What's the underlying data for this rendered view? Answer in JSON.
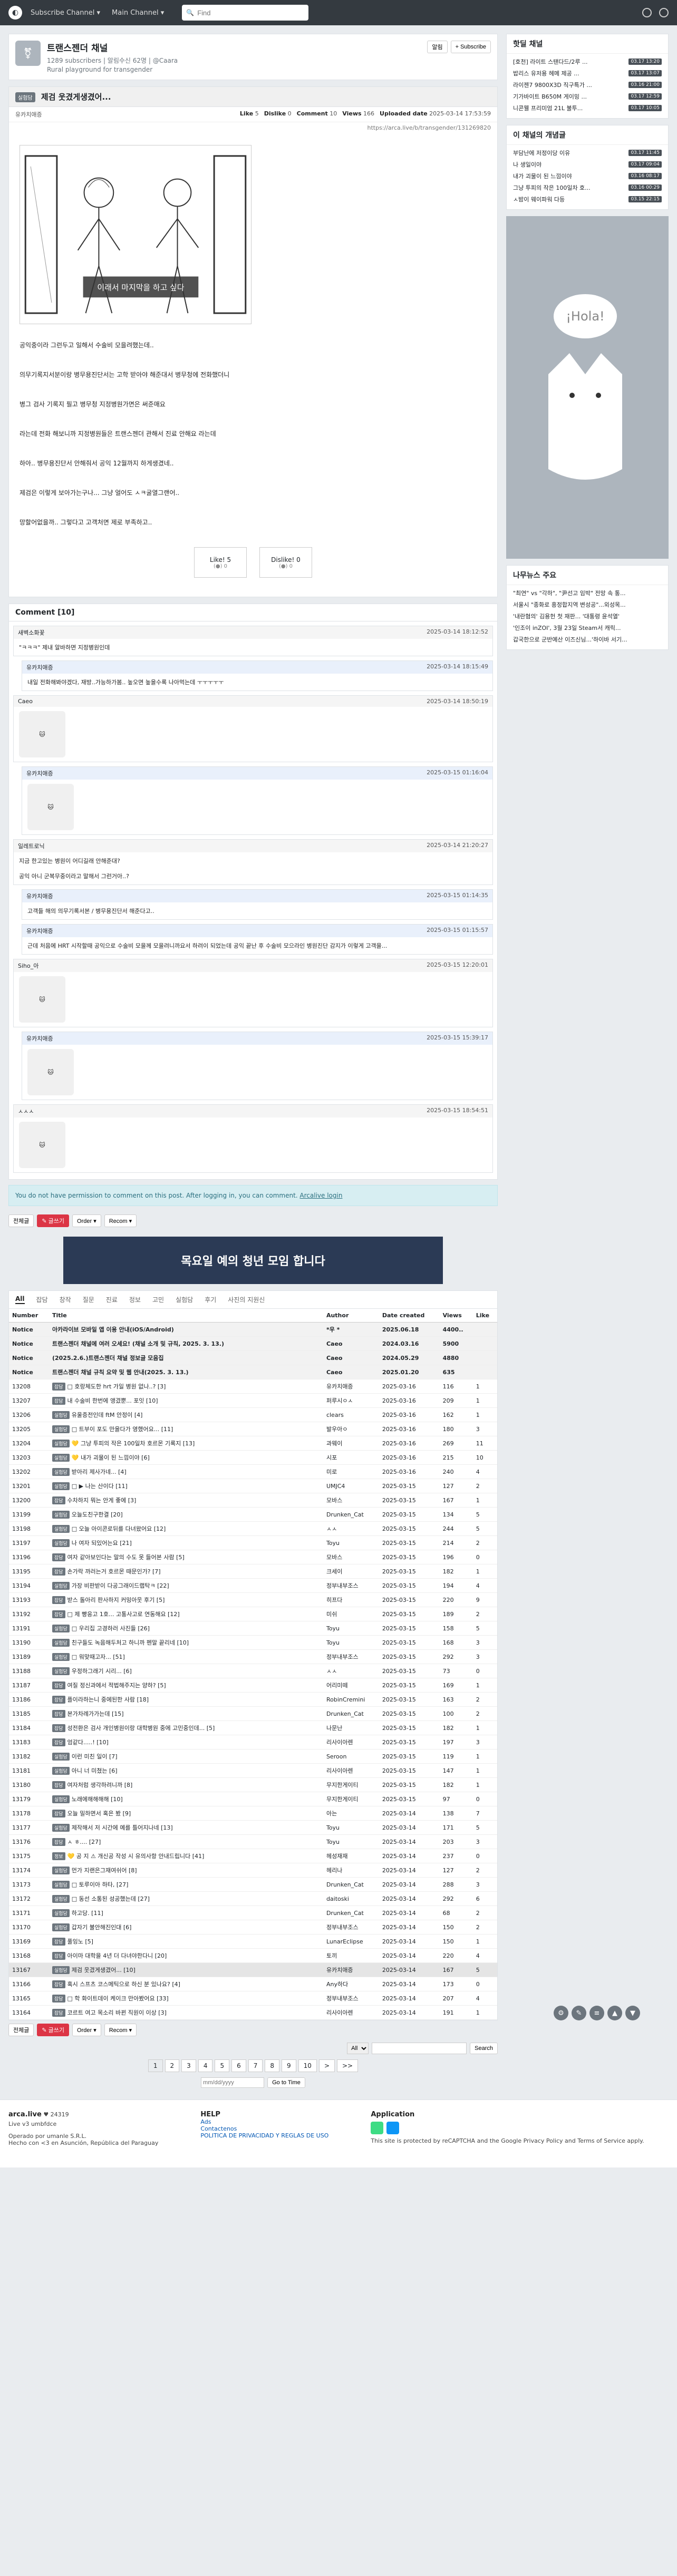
{
  "nav": {
    "subscribe_channel": "Subscribe Channel ▾",
    "main_channel": "Main Channel ▾",
    "search_placeholder": "Find"
  },
  "channel": {
    "title": "트랜스젠더 채널",
    "stats": "1289 subscribers | 알림수신 62명 | @Caara",
    "desc": "Rural playground for transgender",
    "btn_alarm": "알림",
    "btn_subscribe": "+ Subscribe"
  },
  "article": {
    "badge": "실험담",
    "title": "제검 웃겼게생겼어...",
    "author": "유카치애증",
    "like_label": "Like",
    "like_val": "5",
    "dislike_label": "Dislike",
    "dislike_val": "0",
    "comment_label": "Comment",
    "comment_val": "10",
    "views_label": "Views",
    "views_val": "166",
    "uploaded_label": "Uploaded date",
    "uploaded_val": "2025-03-14 17:53:59",
    "link": "https://arca.live/b/transgender/131269820",
    "comic_caption": "이래서 마지막을 하고 싶다",
    "paragraphs": [
      "공익중이라 그런두고 일해서 수술비 모을려했는데..",
      "의무기록지서분이랑 병무용진단서는 고학 받아야 해준대서 병무청에 전화했더니",
      "병그 검사 기록지 필고 병무청 지정병원가면은 써준매요",
      "라는데 전화 해보니까 지정병원들은 트랜스젠더 관해서 진료 안해요 라는데",
      "하아.. 병무용진단서 안해줘서 공익 12월까지 하게생겼네..",
      "제검은 이렇게 보아가는구나... 그냥 얼어도 ㅅㅋ굴열그랜어..",
      "망할어없을까.. 그렇다고 고객처면 제로 부족하고.."
    ],
    "like_btn": "Like! 5",
    "like_count": "(●) 0",
    "dislike_btn": "Dislike! 0",
    "dislike_count": "(●) 0"
  },
  "comments_title": "Comment [10]",
  "comments": [
    {
      "author": "새벽소화꽃",
      "date": "2025-03-14 18:12:52",
      "body": "\"ㅋㅋㅋ\" 제내 알바하면 지정병원인데",
      "reply": false,
      "sticker": false
    },
    {
      "author": "유카치애증",
      "date": "2025-03-14 18:15:49",
      "body": "내일 전화해봐야겠다, 재방..가능하가봄.. 높오면 높을수록 나아먹는데 ㅜㅜㅜㅜㅜ",
      "reply": true,
      "sticker": false
    },
    {
      "author": "Caeo",
      "date": "2025-03-14 18:50:19",
      "body": "",
      "reply": false,
      "sticker": true
    },
    {
      "author": "유카치애증",
      "date": "2025-03-15 01:16:04",
      "body": "",
      "reply": true,
      "sticker": true
    },
    {
      "author": "일레트로닉",
      "date": "2025-03-14 21:20:27",
      "body": "지금 한고있는 병원이 어디길래 안해준대?\n\n공익 아니 군복무중이라고 말해서 그런거아..?",
      "reply": false,
      "sticker": false
    },
    {
      "author": "유카치애증",
      "date": "2025-03-15 01:14:35",
      "body": "고객들 해의 의무기록서본 / 병무용진단서 해준다고..",
      "reply": true,
      "sticker": false
    },
    {
      "author": "유카치애증",
      "date": "2025-03-15 01:15:57",
      "body": "근데 처음에 HRT 시작할때 공익으로 수술비 모을께 모을려니까요서 하려이 되었는데 공익 끝난 후 수술비 모으라인 병원진단 감지가 이렇게 고객을...",
      "reply": true,
      "sticker": false
    },
    {
      "author": "Siho_아",
      "date": "2025-03-15 12:20:01",
      "body": "",
      "reply": false,
      "sticker": true
    },
    {
      "author": "유카치애증",
      "date": "2025-03-15 15:39:17",
      "body": "",
      "reply": true,
      "sticker": true
    },
    {
      "author": "ㅅㅅㅅ",
      "date": "2025-03-15 18:54:51",
      "body": "",
      "reply": false,
      "sticker": true
    }
  ],
  "permission": {
    "text": "You do not have permission to comment on this post. After logging in, you can comment.",
    "link": "Arcalive login"
  },
  "toolbar": {
    "list": "전체글",
    "write": "✎ 글쓰기",
    "order": "Order ▾",
    "recom": "Recom ▾"
  },
  "banner_text": "목요일 예의 청년 모임 합니다",
  "categories": [
    "All",
    "잡담",
    "창작",
    "질문",
    "진료",
    "정보",
    "고민",
    "실험담",
    "후기",
    "사진의 지원신"
  ],
  "table": {
    "headers": [
      "Number",
      "Title",
      "Author",
      "Date created",
      "Views",
      "Like"
    ],
    "rows": [
      {
        "num": "Notice",
        "tag": "",
        "title": "아카라이브 모바일 앱 이용 안내(iOS/Android)",
        "author": "*우 *",
        "date": "2025.06.18",
        "views": "4400..",
        "like": "",
        "type": "notice"
      },
      {
        "num": "Notice",
        "tag": "",
        "title": "트랜스젠더 채널에 여러 오세요! (채널 소개 및 규칙, 2025. 3. 13.)",
        "author": "Caeo",
        "date": "2024.03.16",
        "views": "5900",
        "like": "",
        "type": "notice"
      },
      {
        "num": "Notice",
        "tag": "",
        "title": "(2025.2.6.)트랜스젠더 채널 정보글 모음집",
        "author": "Caeo",
        "date": "2024.05.29",
        "views": "4880",
        "like": "",
        "type": "notice"
      },
      {
        "num": "Notice",
        "tag": "",
        "title": "트랜스젠더 채널 규칙 요약 및 웹 안내(2025. 3. 13.)",
        "author": "Caeo",
        "date": "2025.01.20",
        "views": "635",
        "like": "",
        "type": "notice"
      },
      {
        "num": "13208",
        "tag": "잡담",
        "title": "□ 호랑체도한 hrt 가일 병원 없나..? [3]",
        "author": "유카치애증",
        "date": "2025-03-16",
        "views": "116",
        "like": "1",
        "type": ""
      },
      {
        "num": "13207",
        "tag": "잡담",
        "title": "내 수술비 한번에 앵겼뿐... 포잇 [10]",
        "author": "퍼루시ㅇㅅ",
        "date": "2025-03-16",
        "views": "209",
        "like": "1",
        "type": ""
      },
      {
        "num": "13206",
        "tag": "실험담",
        "title": "유울증전인데 ftM 안정이 [4]",
        "author": "clears",
        "date": "2025-03-16",
        "views": "162",
        "like": "1",
        "type": ""
      },
      {
        "num": "13205",
        "tag": "실험담",
        "title": "□ 트부이 포도 만을다가 영했어요... [11]",
        "author": "발우아ㅇ",
        "date": "2025-03-16",
        "views": "180",
        "like": "3",
        "type": ""
      },
      {
        "num": "13204",
        "tag": "실험담",
        "title": "💛 그냥 투피의 작은 100일차 호르몬 기록지 [13]",
        "author": "과웨이",
        "date": "2025-03-16",
        "views": "269",
        "like": "11",
        "type": ""
      },
      {
        "num": "13203",
        "tag": "실험담",
        "title": "💛 내가 괴물이 된 느낌이야 [6]",
        "author": "시포",
        "date": "2025-03-16",
        "views": "215",
        "like": "10",
        "type": ""
      },
      {
        "num": "13202",
        "tag": "실험담",
        "title": "받아리 제사가네... [4]",
        "author": "미로",
        "date": "2025-03-16",
        "views": "240",
        "like": "4",
        "type": ""
      },
      {
        "num": "13201",
        "tag": "실험담",
        "title": "□ ▶ 나는 산이다 [11]",
        "author": "UMJC4",
        "date": "2025-03-15",
        "views": "127",
        "like": "2",
        "type": ""
      },
      {
        "num": "13200",
        "tag": "잡담",
        "title": "수차하지 뭐는 안게 좋에 [3]",
        "author": "모바스",
        "date": "2025-03-15",
        "views": "167",
        "like": "1",
        "type": ""
      },
      {
        "num": "13199",
        "tag": "실험담",
        "title": "오늘도친구한결 [20]",
        "author": "Drunken_Cat",
        "date": "2025-03-15",
        "views": "134",
        "like": "5",
        "type": ""
      },
      {
        "num": "13198",
        "tag": "실험담",
        "title": "□ 오늘 아이콘로뒤를 다녀왔어요 [12]",
        "author": "ㅅㅅ",
        "date": "2025-03-15",
        "views": "244",
        "like": "5",
        "type": ""
      },
      {
        "num": "13197",
        "tag": "실험담",
        "title": "나 여자 되있어는요 [21]",
        "author": "Toyu",
        "date": "2025-03-15",
        "views": "214",
        "like": "2",
        "type": ""
      },
      {
        "num": "13196",
        "tag": "잡담",
        "title": "여자 같아보인다는 말의 수도 못 들어본 사람 [5]",
        "author": "모바스",
        "date": "2025-03-15",
        "views": "196",
        "like": "0",
        "type": ""
      },
      {
        "num": "13195",
        "tag": "잡담",
        "title": "손가락 까러는거 호르몬 때문인가? [7]",
        "author": "크세이",
        "date": "2025-03-15",
        "views": "182",
        "like": "1",
        "type": ""
      },
      {
        "num": "13194",
        "tag": "실험담",
        "title": "가장 비판받이 다공그래이드랩탁ㅋ [22]",
        "author": "정부내부조스",
        "date": "2025-03-15",
        "views": "194",
        "like": "4",
        "type": ""
      },
      {
        "num": "13193",
        "tag": "잡담",
        "title": "받스 돌아리 판사하지 커밍아웃 후기 [5]",
        "author": "히프다",
        "date": "2025-03-15",
        "views": "220",
        "like": "9",
        "type": ""
      },
      {
        "num": "13192",
        "tag": "잡담",
        "title": "□ 제 빵응고 1호... 고통사고로 연동해요 [12]",
        "author": "미쉬",
        "date": "2025-03-15",
        "views": "189",
        "like": "2",
        "type": ""
      },
      {
        "num": "13191",
        "tag": "실험담",
        "title": "□ 우리집 고경하러 사진들 [26]",
        "author": "Toyu",
        "date": "2025-03-15",
        "views": "158",
        "like": "5",
        "type": ""
      },
      {
        "num": "13190",
        "tag": "실험담",
        "title": "친구들도 녹음해두처고 하니까 펜말 끝리네 [10]",
        "author": "Toyu",
        "date": "2025-03-15",
        "views": "168",
        "like": "3",
        "type": ""
      },
      {
        "num": "13189",
        "tag": "실험담",
        "title": "□ 워맞때고자... [51]",
        "author": "정부내부조스",
        "date": "2025-03-15",
        "views": "292",
        "like": "3",
        "type": ""
      },
      {
        "num": "13188",
        "tag": "실험담",
        "title": "우정하그래기 시리... [6]",
        "author": "ㅅㅅ",
        "date": "2025-03-15",
        "views": "73",
        "like": "0",
        "type": ""
      },
      {
        "num": "13187",
        "tag": "잡담",
        "title": "여질 정신과에서 적법해주지는 양하? [5]",
        "author": "어리미떼",
        "date": "2025-03-15",
        "views": "169",
        "like": "1",
        "type": ""
      },
      {
        "num": "13186",
        "tag": "잡담",
        "title": "플이라하는니 중에된한 사람 [18]",
        "author": "RobinCremini",
        "date": "2025-03-15",
        "views": "163",
        "like": "2",
        "type": ""
      },
      {
        "num": "13185",
        "tag": "잡담",
        "title": "본가차례가가는데 [15]",
        "author": "Drunken_Cat",
        "date": "2025-03-15",
        "views": "100",
        "like": "2",
        "type": ""
      },
      {
        "num": "13184",
        "tag": "잡담",
        "title": "성전환은 검사 개인병원이랑 대학병원 중에 고민중인데... [5]",
        "author": "나문난",
        "date": "2025-03-15",
        "views": "182",
        "like": "1",
        "type": ""
      },
      {
        "num": "13183",
        "tag": "잡담",
        "title": "엄같다.....! [10]",
        "author": "리사이아렌",
        "date": "2025-03-15",
        "views": "197",
        "like": "3",
        "type": ""
      },
      {
        "num": "13182",
        "tag": "실험담",
        "title": "이런 미친 일이 [7]",
        "author": "Seroon",
        "date": "2025-03-15",
        "views": "119",
        "like": "1",
        "type": ""
      },
      {
        "num": "13181",
        "tag": "실험담",
        "title": "아니 너 미쳤는 [6]",
        "author": "리사이아렌",
        "date": "2025-03-15",
        "views": "147",
        "like": "1",
        "type": ""
      },
      {
        "num": "13180",
        "tag": "잡담",
        "title": "여자처럼 생각하려니까 [8]",
        "author": "무지한게이티",
        "date": "2025-03-15",
        "views": "182",
        "like": "1",
        "type": ""
      },
      {
        "num": "13179",
        "tag": "실험담",
        "title": "노래에해해해해 [10]",
        "author": "무지한게이티",
        "date": "2025-03-15",
        "views": "97",
        "like": "0",
        "type": ""
      },
      {
        "num": "13178",
        "tag": "잡담",
        "title": "오늘 밀하면서 혹은 봤 [9]",
        "author": "아는",
        "date": "2025-03-14",
        "views": "138",
        "like": "7",
        "type": ""
      },
      {
        "num": "13177",
        "tag": "실험담",
        "title": "제작해서 저 시간에 예를 틀어지나네 [13]",
        "author": "Toyu",
        "date": "2025-03-14",
        "views": "171",
        "like": "5",
        "type": ""
      },
      {
        "num": "13176",
        "tag": "잡담",
        "title": "ㅅ ㅎ.... [27]",
        "author": "Toyu",
        "date": "2025-03-14",
        "views": "203",
        "like": "3",
        "type": ""
      },
      {
        "num": "13175",
        "tag": "정보",
        "title": "💛 공 지 ⚠ 개신공 작성 시 유의사항 안내드립니다 [41]",
        "author": "헤성재재",
        "date": "2025-03-14",
        "views": "237",
        "like": "0",
        "type": ""
      },
      {
        "num": "13174",
        "tag": "실험담",
        "title": "먼가 지랜은그재여쉬어 [8]",
        "author": "헤리나",
        "date": "2025-03-14",
        "views": "127",
        "like": "2",
        "type": ""
      },
      {
        "num": "13173",
        "tag": "실험담",
        "title": "□ 토루이아 하타, [27]",
        "author": "Drunken_Cat",
        "date": "2025-03-14",
        "views": "288",
        "like": "3",
        "type": ""
      },
      {
        "num": "13172",
        "tag": "실험담",
        "title": "□ 동선 소통된 성공했는데 [27]",
        "author": "daitoski",
        "date": "2025-03-14",
        "views": "292",
        "like": "6",
        "type": ""
      },
      {
        "num": "13171",
        "tag": "실험담",
        "title": "하고당. [11]",
        "author": "Drunken_Cat",
        "date": "2025-03-14",
        "views": "68",
        "like": "2",
        "type": ""
      },
      {
        "num": "13170",
        "tag": "실험담",
        "title": "갑자기 불안해진인대 [6]",
        "author": "정부내부조스",
        "date": "2025-03-14",
        "views": "150",
        "like": "2",
        "type": ""
      },
      {
        "num": "13169",
        "tag": "잡담",
        "title": "풀잉노 [5]",
        "author": "LunarEclipse",
        "date": "2025-03-14",
        "views": "150",
        "like": "1",
        "type": ""
      },
      {
        "num": "13168",
        "tag": "잡담",
        "title": "아이마 대학을 4년 더 다녀야한다니 [20]",
        "author": "토끼",
        "date": "2025-03-14",
        "views": "220",
        "like": "4",
        "type": ""
      },
      {
        "num": "13167",
        "tag": "실험담",
        "title": "제검 웃겼게생겼어... [10]",
        "author": "유카치애증",
        "date": "2025-03-14",
        "views": "167",
        "like": "5",
        "type": "hl"
      },
      {
        "num": "13166",
        "tag": "잡담",
        "title": "혹시 스프츠 코스메틱으로 하신 분 있나요? [4]",
        "author": "Any하다",
        "date": "2025-03-14",
        "views": "173",
        "like": "0",
        "type": ""
      },
      {
        "num": "13165",
        "tag": "잡담",
        "title": "□ 학 화이트데이 케이크 만아봤어요 [33]",
        "author": "정부내부조스",
        "date": "2025-03-14",
        "views": "207",
        "like": "4",
        "type": ""
      },
      {
        "num": "13164",
        "tag": "잡담",
        "title": "코르트 여고 목소리 바뀐 직원이 이상 [3]",
        "author": "리사이아렌",
        "date": "2025-03-14",
        "views": "191",
        "like": "1",
        "type": ""
      }
    ]
  },
  "pager": [
    "1",
    "2",
    "3",
    "4",
    "5",
    "6",
    "7",
    "8",
    "9",
    "10",
    ">",
    ">>"
  ],
  "search": {
    "select": "All",
    "button": "Search",
    "date_placeholder": "mm/dd/yyyy",
    "go": "Go to Time"
  },
  "footer": {
    "brand": "arca.live",
    "brand_count": "♥ 24319",
    "version": "Live v3 umbfdce",
    "operator": "Operado por umanle S.R.L.",
    "address": "Hecho con <3 en Asunción, República del Paraguay",
    "help_title": "HELP",
    "help_ads": "Ads",
    "help_contact": "Contactenos",
    "help_policy": "POLITICA DE PRIVACIDAD Y REGLAS DE USO",
    "app_title": "Application",
    "recaptcha": "This site is protected by reCAPTCHA and the Google Privacy Policy and Terms of Service apply."
  },
  "sidebar": {
    "hot_title": "핫딜 채널",
    "hot": [
      {
        "t": "[호천] 라이트 스탠다드/2루 ...",
        "ts": "03.17 13:20"
      },
      {
        "t": "밥리스 유저용 헤메 제공 ...",
        "ts": "03.17 13:07"
      },
      {
        "t": "라이젠7 9800X3D 직구특가 ...",
        "ts": "03.16 21:00"
      },
      {
        "t": "기가바이트 B650M 게이밍 ...",
        "ts": "03.17 12:59"
      },
      {
        "t": "니콘웰 프리미엄 21L 불투...",
        "ts": "03.17 10:05"
      }
    ],
    "concept_title": "이 채널의 개념글",
    "concept": [
      {
        "t": "부담난에 저정이당 이유",
        "ts": "03.17 11:45"
      },
      {
        "t": "나 생일이야",
        "ts": "03.17 09:04"
      },
      {
        "t": "내가 괴물이 된 느낌이야",
        "ts": "03.16 08:17"
      },
      {
        "t": "그냥 투피의 작은 100일차 호...",
        "ts": "03.16 00:29"
      },
      {
        "t": "ㅅ밤이 웨이파워 다등",
        "ts": "03.15 22:15"
      }
    ],
    "ad_text": "¡Hola!",
    "news_title": "나무뉴스 주요",
    "news": [
      "\"최연\" vs \"각하\", \"尹선고 임박\" 전망 속 통...",
      "서울시 \"종화로 흥정합지역 변성공\"...외성목...",
      "'내란혐의' 김용헌 첫 재판... '대통령 윤석열'",
      "'인조이 inZOI', 3월 23일 Steam서 캐릭...",
      "갑국한으로 군반예산 이즈신님...'하이바 서기..."
    ]
  }
}
